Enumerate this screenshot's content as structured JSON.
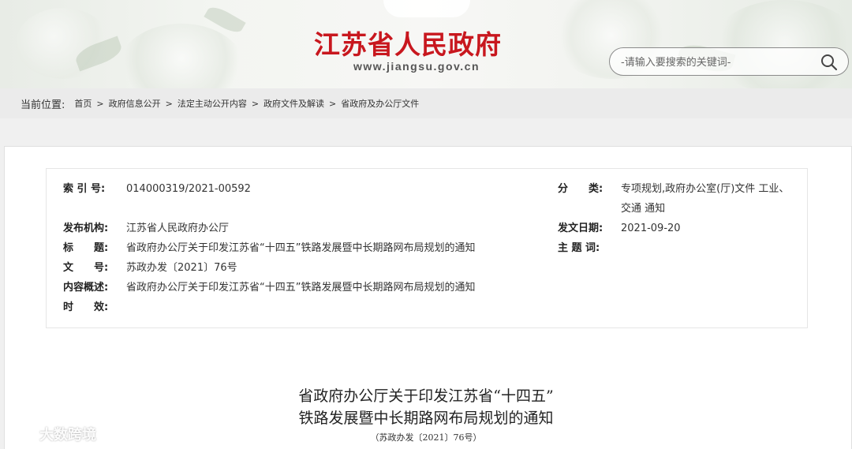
{
  "header": {
    "site_title": "江苏省人民政府",
    "site_url": "www.jiangsu.gov.cn",
    "search_placeholder": "-请输入要搜索的关键词-",
    "title_color": "#c8171e"
  },
  "breadcrumb": {
    "prefix": "当前位置:",
    "items": [
      "首页",
      "政府信息公开",
      "法定主动公开内容",
      "政府文件及解读",
      "省政府及办公厅文件"
    ],
    "separator": ">"
  },
  "meta": {
    "index_label": "索 引 号:",
    "index_value": "014000319/2021-00592",
    "category_label": "分　　类:",
    "category_value_line1": "专项规划,政府办公室(厅)文件 工业、",
    "category_value_line2": "交通 通知",
    "issuer_label": "发布机构:",
    "issuer_value": "江苏省人民政府办公厅",
    "date_label": "发文日期:",
    "date_value": "2021-09-20",
    "title_label": "标　　题:",
    "title_value": "省政府办公厅关于印发江苏省“十四五”铁路发展暨中长期路网布局规划的通知",
    "subject_label": "主 题 词:",
    "subject_value": "",
    "docno_label": "文　　号:",
    "docno_value": "苏政办发〔2021〕76号",
    "summary_label": "内容概述:",
    "summary_value": "省政府办公厅关于印发江苏省“十四五”铁路发展暨中长期路网布局规划的通知",
    "validity_label": "时　　效:",
    "validity_value": ""
  },
  "document": {
    "title_line1": "省政府办公厅关于印发江苏省“十四五”",
    "title_line2": "铁路发展暨中长期路网布局规划的通知",
    "doc_number": "（苏政办发〔2021〕76号）"
  },
  "watermark": {
    "text": "大数跨境"
  }
}
